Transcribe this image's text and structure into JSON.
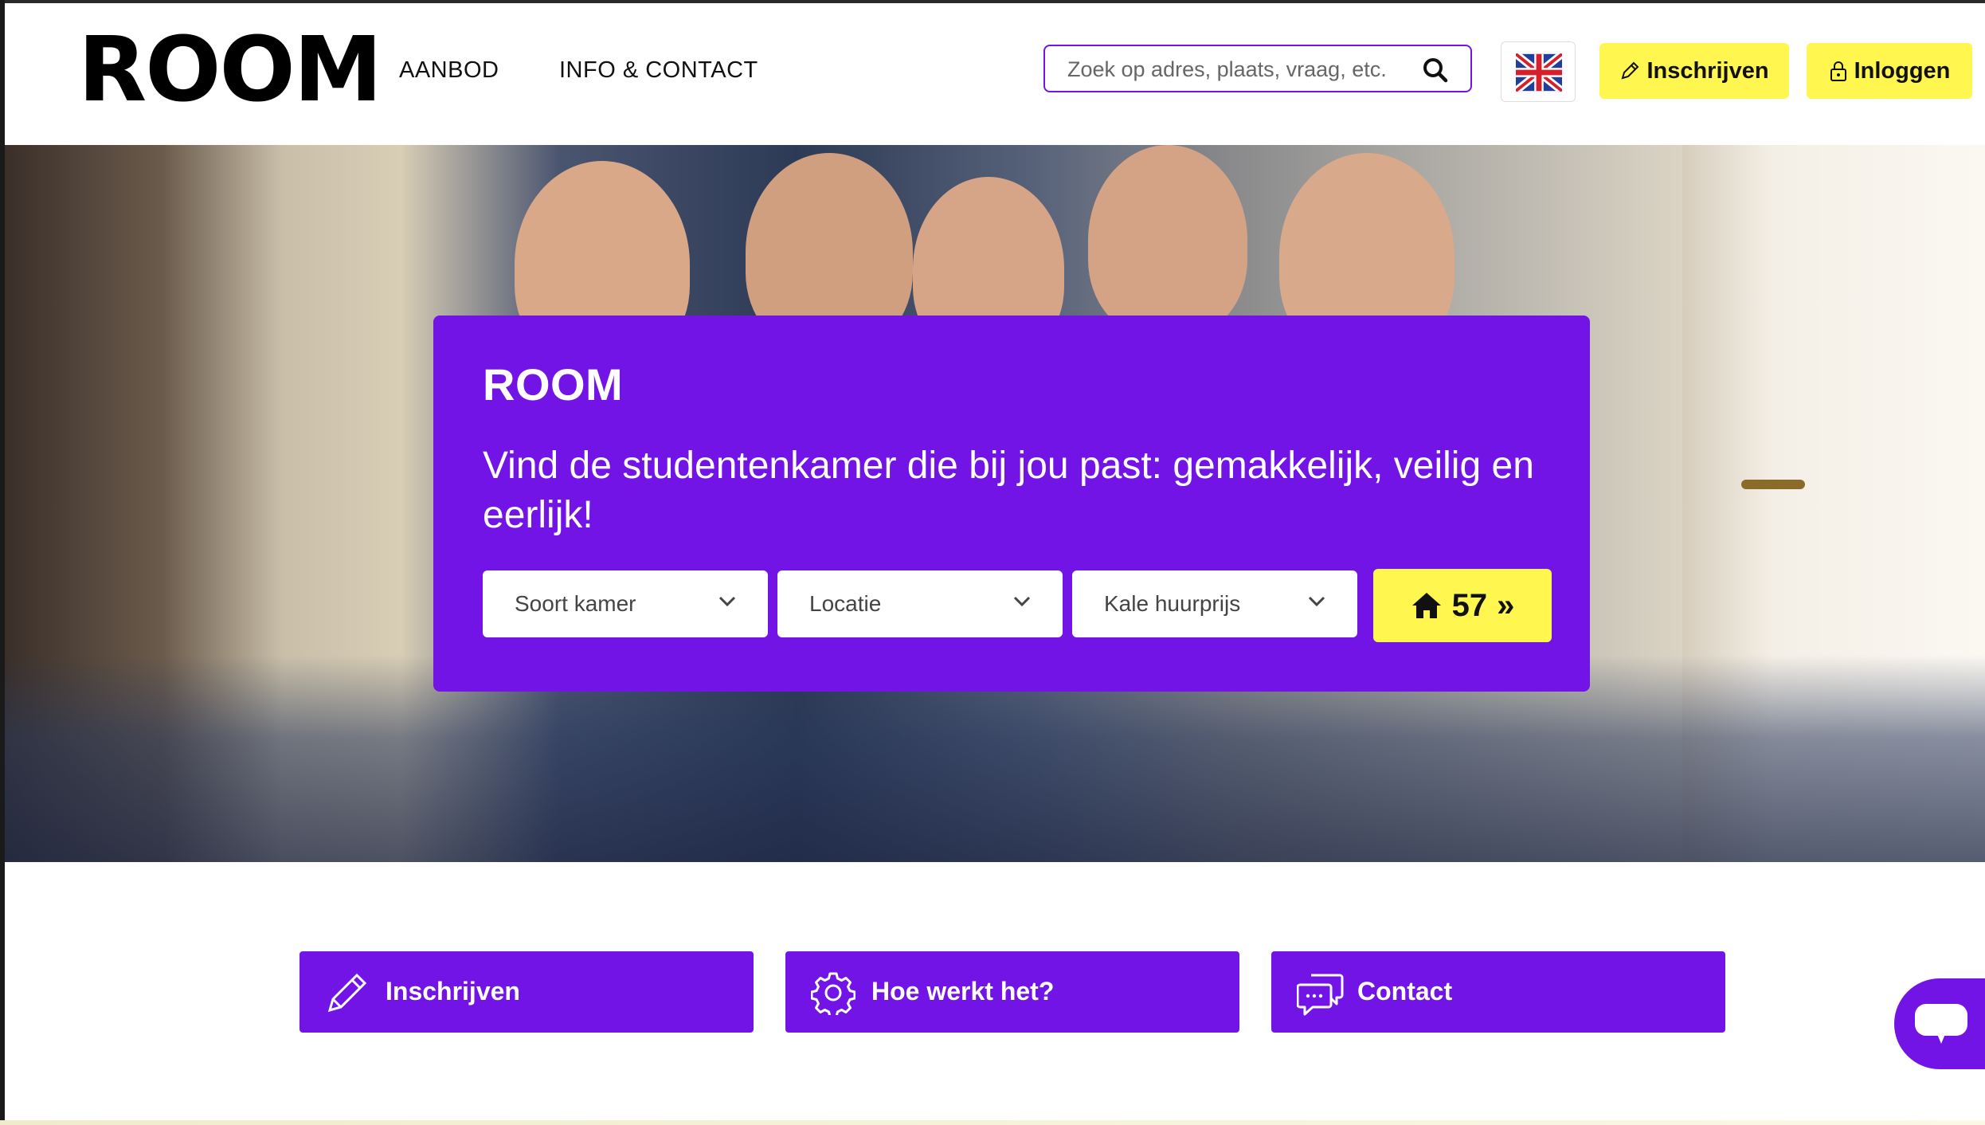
{
  "colors": {
    "brand_purple": "#7214e6",
    "accent_yellow": "#fff650",
    "text_dark": "#111111"
  },
  "header": {
    "logo": "ROOM",
    "nav": {
      "aanbod": "AANBOD",
      "info_contact": "INFO & CONTACT"
    },
    "search": {
      "placeholder": "Zoek op adres, plaats, vraag, etc."
    },
    "language_icon": "uk-flag-icon",
    "signup_label": "Inschrijven",
    "login_label": "Inloggen"
  },
  "hero": {
    "title": "ROOM",
    "tagline": "Vind de studentenkamer die bij jou past: gemakkelijk, veilig en eerlijk!",
    "filters": {
      "room_type": "Soort kamer",
      "location": "Locatie",
      "rent": "Kale huurprijs"
    },
    "result_count": "57",
    "result_arrow": "»"
  },
  "cards": {
    "signup": "Inschrijven",
    "how_it_works": "Hoe werkt het?",
    "contact": "Contact"
  }
}
